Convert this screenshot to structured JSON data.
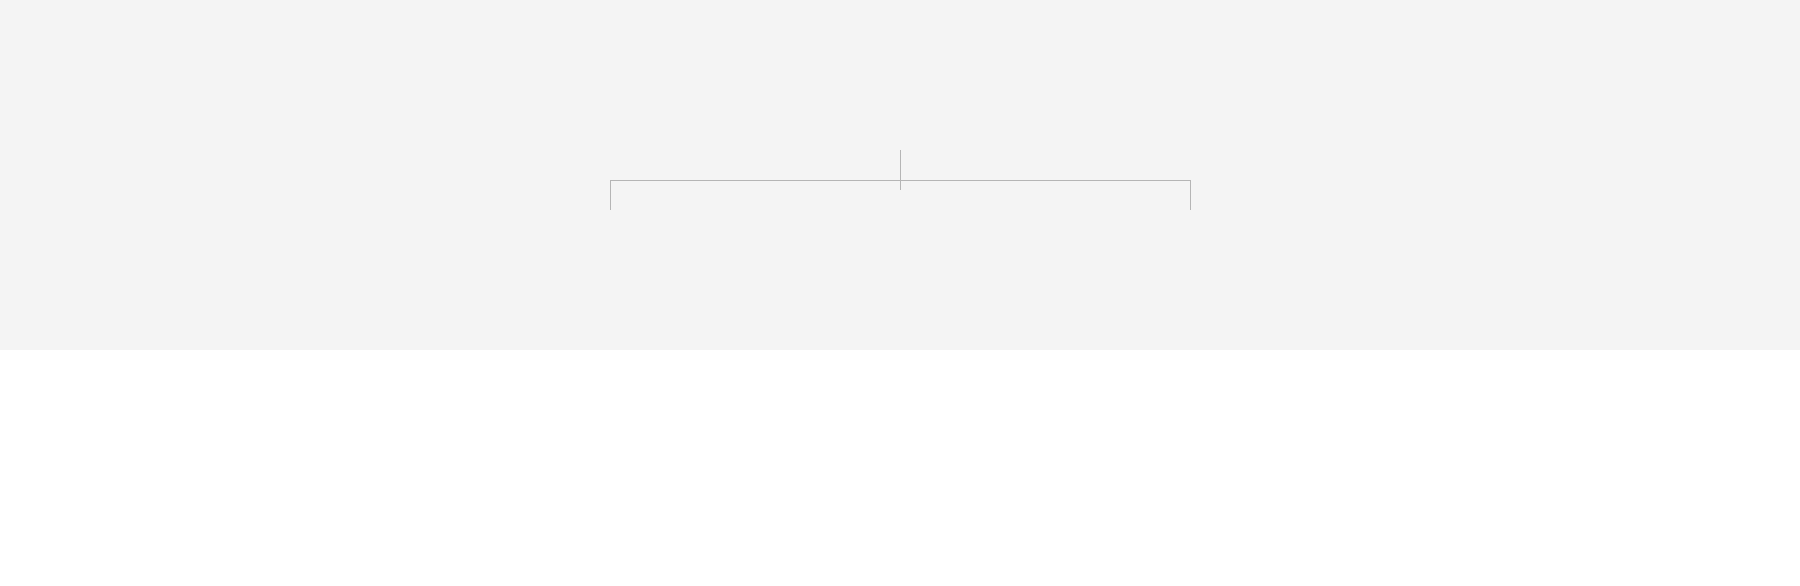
{
  "diagram": {
    "kind": "tree-connector",
    "root_children": 2,
    "colors": {
      "canvas_background": "#f4f4f4",
      "page_background": "#ffffff",
      "connector_line": "#b5b5b5"
    }
  }
}
